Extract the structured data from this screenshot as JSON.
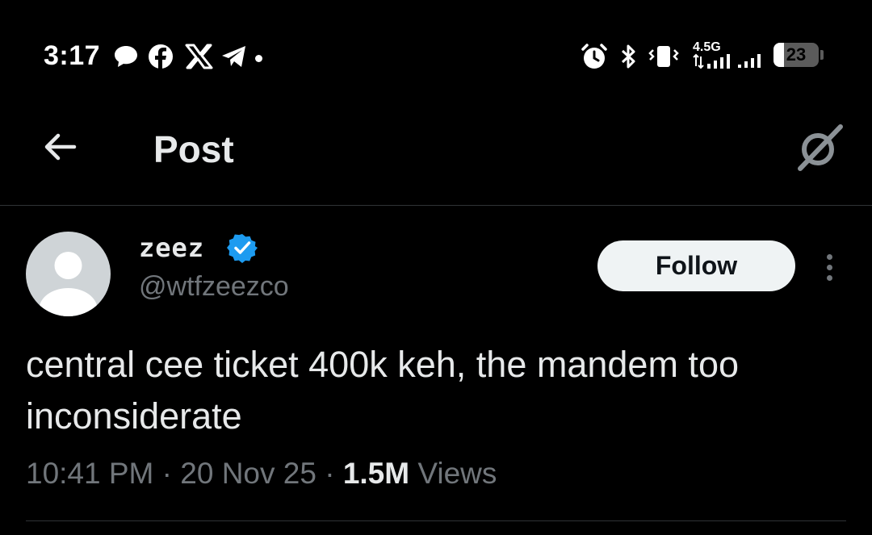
{
  "status_bar": {
    "time": "3:17",
    "notification_icons": [
      "message-bubble-icon",
      "facebook-icon",
      "x-icon",
      "telegram-icon",
      "dot-icon"
    ],
    "right_icons": [
      "alarm-icon",
      "bluetooth-icon",
      "vibrate-icon",
      "signal-icon",
      "signal-icon",
      "battery-icon"
    ],
    "network_label": "4.5G",
    "battery_level": "23",
    "battery_fraction": 0.23
  },
  "header": {
    "title": "Post"
  },
  "post": {
    "display_name": "zeez",
    "handle": "@wtfzeezco",
    "follow_label": "Follow",
    "text": "central cee ticket 400k keh, the mandem too inconsiderate",
    "time": "10:41 PM",
    "date": "20 Nov 25",
    "views_count": "1.5M",
    "views_label": "Views",
    "separator": "·"
  },
  "colors": {
    "background": "#000000",
    "text_primary": "#e7e9ea",
    "text_secondary": "#71767b",
    "verified": "#1d9bf0",
    "follow_bg": "#eff3f4"
  }
}
